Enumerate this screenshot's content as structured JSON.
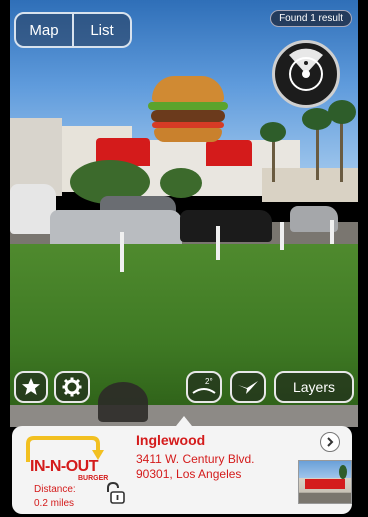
{
  "view_toggle": {
    "map_label": "Map",
    "list_label": "List"
  },
  "results": {
    "text": "Found 1 result"
  },
  "controls": {
    "favorite_icon": "star-icon",
    "settings_icon": "gear-icon",
    "tilt_label": "2°",
    "bird_icon": "bird-icon",
    "layers_label": "Layers"
  },
  "poi": {
    "name": "Inglewood",
    "address_line1": "3411 W. Century Blvd.",
    "address_line2": "90301, Los Angeles",
    "distance_label": "Distance:",
    "distance_value": "0.2 miles",
    "logo_text": "IN-N-OUT",
    "logo_sub": "BURGER"
  },
  "colors": {
    "accent": "#d41b1b",
    "card": "#f4f4f4",
    "control_border": "#e8e8e8"
  }
}
